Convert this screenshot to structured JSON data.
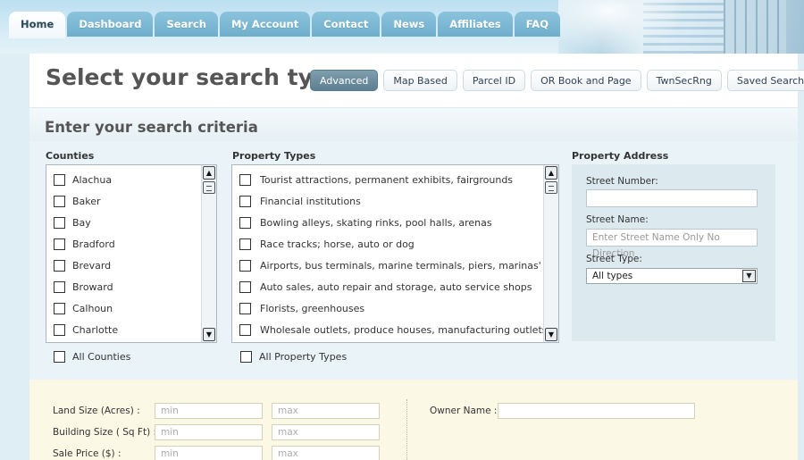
{
  "nav": {
    "tabs": [
      "Home",
      "Dashboard",
      "Search",
      "My Account",
      "Contact",
      "News",
      "Affiliates",
      "FAQ"
    ],
    "active": "Home"
  },
  "search_type": {
    "title": "Select your search type:",
    "buttons": [
      "Advanced",
      "Map Based",
      "Parcel ID",
      "OR Book and Page",
      "TwnSecRng",
      "Saved Searches"
    ],
    "active": "Advanced"
  },
  "criteria": {
    "title": "Enter your search criteria"
  },
  "counties": {
    "label": "Counties",
    "items": [
      "Alachua",
      "Baker",
      "Bay",
      "Bradford",
      "Brevard",
      "Broward",
      "Calhoun",
      "Charlotte"
    ],
    "all_label": "All Counties"
  },
  "property_types": {
    "label": "Property Types",
    "items": [
      "Tourist attractions, permanent exhibits, fairgrounds",
      "Financial institutions",
      "Bowling alleys, skating rinks, pool halls, arenas",
      "Race tracks; horse, auto or dog",
      "Airports, bus terminals, marine terminals, piers, marinas'",
      "Auto sales, auto repair and storage, auto service shops",
      "Florists, greenhouses",
      "Wholesale outlets, produce houses, manufacturing outlets"
    ],
    "all_label": "All Property Types"
  },
  "address": {
    "label": "Property Address",
    "street_number_label": "Street Number:",
    "street_number_value": "",
    "street_name_label": "Street Name:",
    "street_name_placeholder": "Enter Street Name Only No Direction",
    "street_type_label": "Street Type:",
    "street_type_value": "All types"
  },
  "filters": {
    "land_size_label": "Land Size (Acres) :",
    "building_size_label": "Building Size ( Sq Ft) :",
    "sale_price_label": "Sale Price ($) :",
    "min_placeholder": "min",
    "max_placeholder": "max",
    "owner_name_label": "Owner Name :",
    "owner_name_value": ""
  },
  "colors": {
    "tab": "#6eaecb",
    "active_button": "#5d7f91",
    "panel": "#e9f3f8",
    "cream": "#fcf8e6"
  }
}
